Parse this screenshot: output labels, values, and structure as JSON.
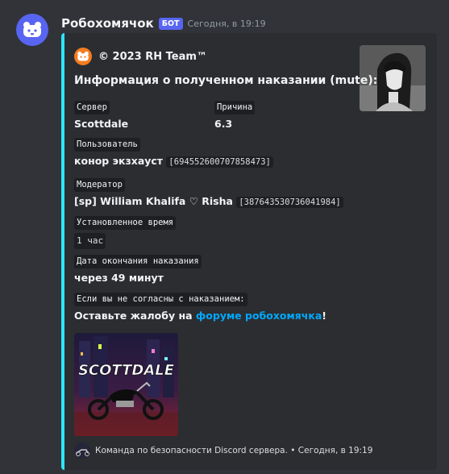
{
  "message": {
    "username": "Робохомячок",
    "badge": "БОТ",
    "timestamp": "Сегодня, в 19:19"
  },
  "embed": {
    "accent_color": "#2ee6ff",
    "author": "© 2023 RH Team™",
    "title": "Информация о полученном наказании (mute):",
    "fields": {
      "server": {
        "name": "Сервер",
        "value": "Scottdale"
      },
      "reason": {
        "name": "Причина",
        "value": "6.3"
      },
      "user": {
        "name": "Пользователь",
        "value": "конор экзхауст",
        "id": "[694552600707858473]"
      },
      "moderator": {
        "name": "Модератор",
        "value": "[sp] William Khalifa ♡ Risha",
        "id": "[387643530736041984]"
      },
      "duration": {
        "name": "Установленное время",
        "value": "1 час"
      },
      "end": {
        "name": "Дата окончания наказания",
        "value": "через 49 минут"
      },
      "appeal": {
        "name": "Если вы не согласны с наказанием:",
        "text_before": "Оставьте жалобу на ",
        "link_text": "форуме робохомячка",
        "text_after": "!"
      }
    },
    "image_text": "SCOTTDALE",
    "footer": {
      "text": "Команда по безопасности Discord сервера.",
      "separator": " • ",
      "timestamp": "Сегодня, в 19:19"
    }
  }
}
